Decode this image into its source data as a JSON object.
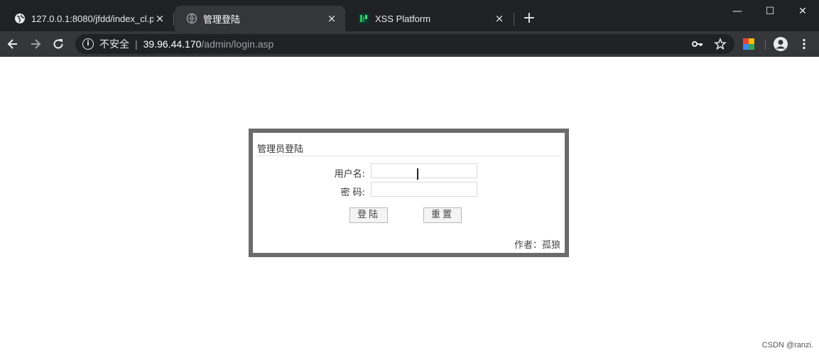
{
  "tabs": [
    {
      "title": "127.0.0.1:8080/jfdd/index_cl.p",
      "favicon": "globe-icon",
      "active": false
    },
    {
      "title": "管理登陆",
      "favicon": "globe-icon",
      "active": true
    },
    {
      "title": "XSS Platform",
      "favicon": "xss-favicon",
      "active": false
    }
  ],
  "tab_close_glyph": "×",
  "new_tab_glyph": "+",
  "window_controls": {
    "minimize": "—",
    "maximize": "☐",
    "close": "✕"
  },
  "omnibox": {
    "security_label": "不安全",
    "separator": "|",
    "host": "39.96.44.170",
    "path": "/admin/login.asp"
  },
  "login": {
    "title": "管理员登陆",
    "username_label": "用户名:",
    "password_label": "密 码:",
    "username_value": "",
    "password_value": "",
    "login_button": "登陆",
    "reset_button": "重置",
    "author": "作者：孤狼"
  },
  "watermark": "CSDN @ranzi.",
  "colors": {
    "tabstrip": "#202124",
    "toolbar": "#35363a",
    "login_border": "#6b6b6b"
  }
}
